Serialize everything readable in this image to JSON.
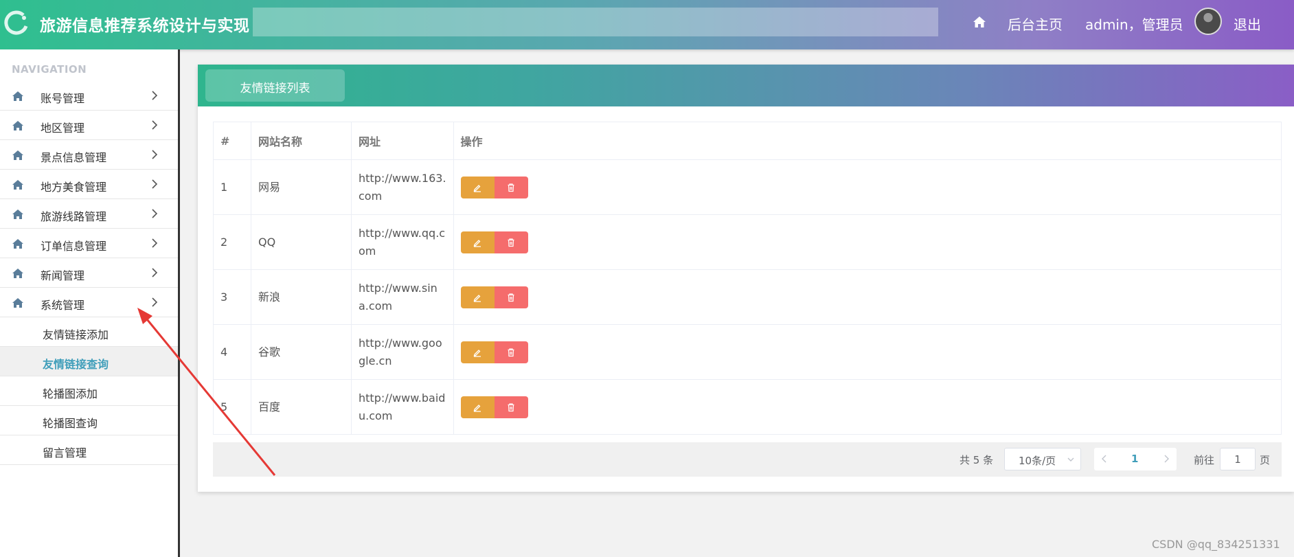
{
  "header": {
    "app_title": "旅游信息推荐系统设计与实现",
    "backend_home": "后台主页",
    "user": "admin，管理员",
    "logout": "退出"
  },
  "sidebar": {
    "caption": "NAVIGATION",
    "items": [
      {
        "label": "账号管理",
        "icon": "home-icon"
      },
      {
        "label": "地区管理",
        "icon": "home-icon"
      },
      {
        "label": "景点信息管理",
        "icon": "home-icon"
      },
      {
        "label": "地方美食管理",
        "icon": "home-icon"
      },
      {
        "label": "旅游线路管理",
        "icon": "home-icon"
      },
      {
        "label": "订单信息管理",
        "icon": "home-icon"
      },
      {
        "label": "新闻管理",
        "icon": "home-icon"
      },
      {
        "label": "系统管理",
        "icon": "home-icon"
      }
    ],
    "sub_items": [
      {
        "label": "友情链接添加",
        "active": false
      },
      {
        "label": "友情链接查询",
        "active": true
      },
      {
        "label": "轮播图添加",
        "active": false
      },
      {
        "label": "轮播图查询",
        "active": false
      },
      {
        "label": "留言管理",
        "active": false
      }
    ]
  },
  "main": {
    "tab_title": "友情链接列表",
    "table": {
      "headers": [
        "#",
        "网站名称",
        "网址",
        "操作"
      ],
      "rows": [
        {
          "idx": "1",
          "name": "网易",
          "url_line1": "http://www.163.",
          "url_line2": "com"
        },
        {
          "idx": "2",
          "name": "QQ",
          "url_line1": "http://www.qq.c",
          "url_line2": "om"
        },
        {
          "idx": "3",
          "name": "新浪",
          "url_line1": "http://www.sin",
          "url_line2": "a.com"
        },
        {
          "idx": "4",
          "name": "谷歌",
          "url_line1": "http://www.goo",
          "url_line2": "gle.cn"
        },
        {
          "idx": "5",
          "name": "百度",
          "url_line1": "http://www.baid",
          "url_line2": "u.com"
        }
      ]
    },
    "pagination": {
      "total": "共 5 条",
      "page_size": "10条/页",
      "current_page": "1",
      "goto_label": "前往",
      "goto_value": "1",
      "page_suffix": "页"
    }
  },
  "watermark": "CSDN @qq_834251331",
  "colors": {
    "edit_button": "#e6a23c",
    "delete_button": "#f56c6c",
    "accent": "#409eba",
    "annotation_arrow": "#e53935"
  }
}
